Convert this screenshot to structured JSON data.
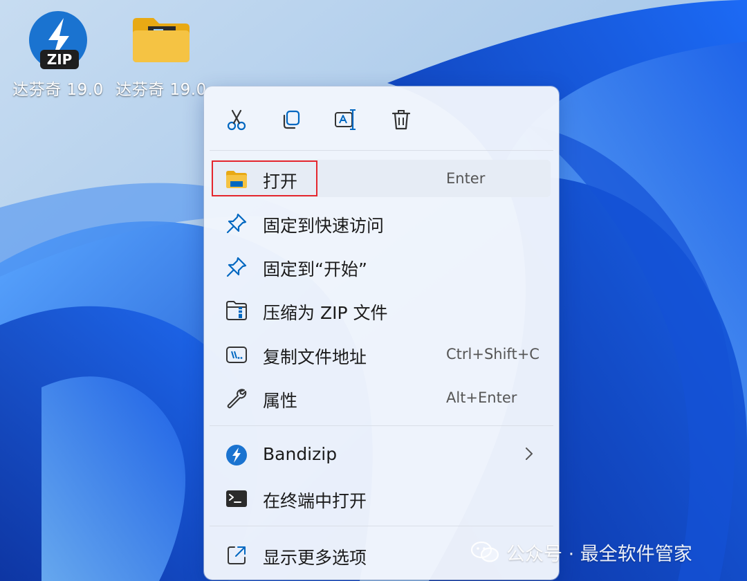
{
  "desktop": {
    "icons": [
      {
        "label": "达芬奇 19.0",
        "icon": "zip-archive-icon",
        "badge": "ZIP"
      },
      {
        "label": "达芬奇 19.0",
        "icon": "folder-icon"
      }
    ]
  },
  "context_menu": {
    "toolbar": [
      {
        "icon": "cut-icon",
        "action": "cut"
      },
      {
        "icon": "copy-icon",
        "action": "copy"
      },
      {
        "icon": "rename-icon",
        "action": "rename"
      },
      {
        "icon": "delete-icon",
        "action": "delete"
      }
    ],
    "items": [
      {
        "label": "打开",
        "shortcut": "Enter",
        "icon": "folder-open-icon"
      },
      {
        "label": "固定到快速访问",
        "icon": "pin-icon"
      },
      {
        "label": "固定到“开始”",
        "icon": "pin-icon"
      },
      {
        "label": "压缩为 ZIP 文件",
        "icon": "zip-folder-icon"
      },
      {
        "label": "复制文件地址",
        "shortcut": "Ctrl+Shift+C",
        "icon": "copy-path-icon"
      },
      {
        "label": "属性",
        "shortcut": "Alt+Enter",
        "icon": "wrench-icon"
      },
      {
        "label": "Bandizip",
        "icon": "bandizip-icon",
        "has_submenu": true
      },
      {
        "label": "在终端中打开",
        "icon": "terminal-icon"
      },
      {
        "label": "显示更多选项",
        "icon": "more-options-icon"
      }
    ],
    "highlighted_item": "打开",
    "highlight_color": "#e5262d"
  },
  "watermark": {
    "text": "公众号 · 最全软件管家",
    "icon": "wechat-icon"
  },
  "colors": {
    "accent": "#0067c0",
    "zip_blue": "#1a73d0",
    "folder_yellow": "#f5c343"
  }
}
